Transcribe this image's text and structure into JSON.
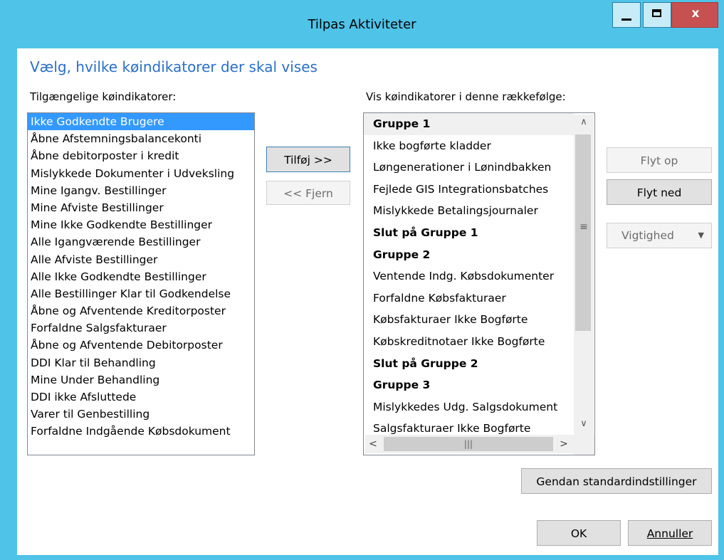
{
  "window": {
    "title": "Tilpas Aktiviteter",
    "close_glyph": "x"
  },
  "heading": "Vælg, hvilke køindikatorer der skal vises",
  "available": {
    "label": "Tilgængelige køindikatorer:",
    "selected_index": 0,
    "items": [
      "Ikke Godkendte Brugere",
      "Åbne Afstemningsbalancekonti",
      "Åbne debitorposter i kredit",
      "Mislykkede Dokumenter i Udveksling",
      "Mine Igangv. Bestillinger",
      "Mine Afviste Bestillinger",
      "Mine Ikke Godkendte Bestillinger",
      "Alle Igangværende Bestillinger",
      "Alle Afviste Bestillinger",
      "Alle Ikke Godkendte Bestillinger",
      "Alle Bestillinger Klar til Godkendelse",
      "Åbne og Afventende Kreditorposter",
      "Forfaldne Salgsfakturaer",
      "Åbne og Afventende Debitorposter",
      "DDI Klar til Behandling",
      "Mine Under Behandling",
      "DDI ikke Afsluttede",
      "Varer til Genbestilling",
      "Forfaldne Indgående Købsdokument"
    ]
  },
  "transfer": {
    "add_label": "Tilføj >>",
    "remove_label": "<< Fjern"
  },
  "order": {
    "label": "Vis køindikatorer i denne rækkefølge:",
    "items": [
      {
        "text": "Gruppe 1",
        "bold": true,
        "highlight": true
      },
      {
        "text": "Ikke bogførte kladder",
        "bold": false
      },
      {
        "text": "Løngenerationer i Lønindbakken",
        "bold": false
      },
      {
        "text": "Fejlede GIS Integrationsbatches",
        "bold": false
      },
      {
        "text": "Mislykkede Betalingsjournaler",
        "bold": false
      },
      {
        "text": "Slut på Gruppe 1",
        "bold": true
      },
      {
        "text": "Gruppe 2",
        "bold": true
      },
      {
        "text": "Ventende Indg. Købsdokumenter",
        "bold": false
      },
      {
        "text": "Forfaldne Købsfakturaer",
        "bold": false
      },
      {
        "text": "Købsfakturaer Ikke Bogførte",
        "bold": false
      },
      {
        "text": "Købskreditnotaer Ikke Bogførte",
        "bold": false
      },
      {
        "text": "Slut på Gruppe 2",
        "bold": true
      },
      {
        "text": "Gruppe 3",
        "bold": true
      },
      {
        "text": "Mislykkedes Udg. Salgsdokument",
        "bold": false
      },
      {
        "text": "Salgsfakturaer Ikke Bogførte",
        "bold": false
      }
    ]
  },
  "side_buttons": {
    "move_up": "Flyt op",
    "move_down": "Flyt ned",
    "priority": "Vigtighed"
  },
  "footer": {
    "reset_label": "Gendan standardindstillinger",
    "ok_label": "OK",
    "cancel_label": "Annuller"
  },
  "colors": {
    "frame": "#4fc3e8",
    "heading": "#2a6fc9",
    "selection": "#3399ff",
    "close_button": "#c75050"
  }
}
